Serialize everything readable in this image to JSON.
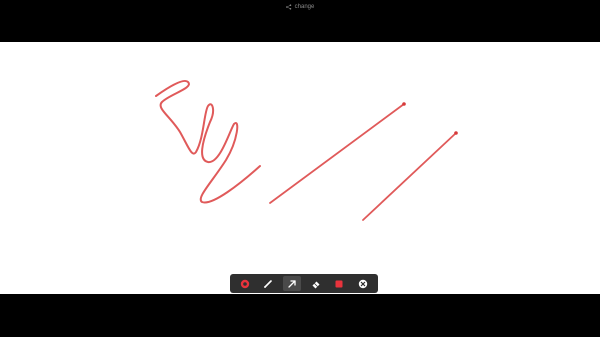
{
  "header": {
    "share_label": "change"
  },
  "toolbar": {
    "tools": [
      {
        "name": "record",
        "icon": "record-icon",
        "active": false
      },
      {
        "name": "pen",
        "icon": "pen-icon",
        "active": false
      },
      {
        "name": "arrow",
        "icon": "arrow-icon",
        "active": true
      },
      {
        "name": "eraser",
        "icon": "eraser-icon",
        "active": false
      },
      {
        "name": "color",
        "icon": "color-swatch-icon",
        "active": false
      },
      {
        "name": "close",
        "icon": "close-icon",
        "active": false
      }
    ]
  },
  "colors": {
    "ink": "#e05a5a",
    "accent": "#e8333c",
    "toolbar_bg": "#2f2f2f",
    "canvas_bg": "#ffffff"
  }
}
